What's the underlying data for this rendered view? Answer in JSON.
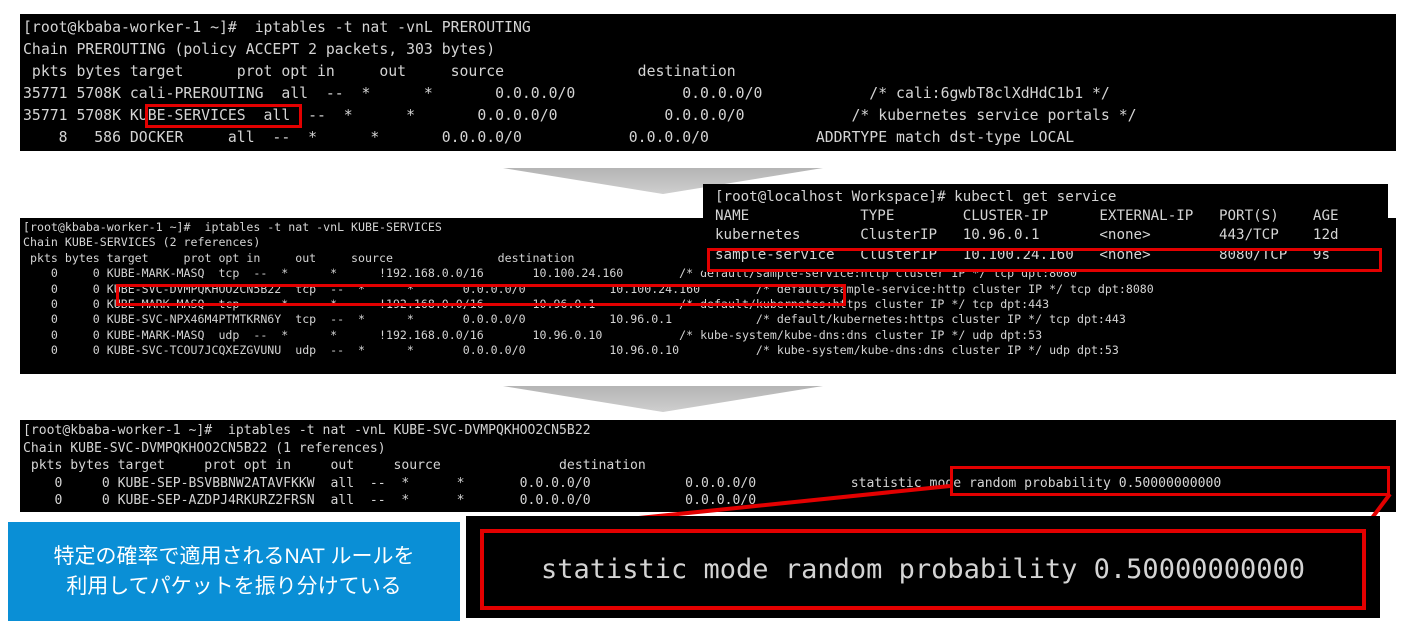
{
  "terminal1": {
    "lines": [
      "[root@kbaba-worker-1 ~]#  iptables -t nat -vnL PREROUTING",
      "Chain PREROUTING (policy ACCEPT 2 packets, 303 bytes)",
      " pkts bytes target      prot opt in     out     source               destination",
      "35771 5708K cali-PREROUTING  all  --  *      *       0.0.0.0/0            0.0.0.0/0            /* cali:6gwbT8clXdHdC1b1 */",
      "35771 5708K KUBE-SERVICES  all  --  *      *       0.0.0.0/0            0.0.0.0/0            /* kubernetes service portals */",
      "    8   586 DOCKER     all  --  *      *       0.0.0.0/0            0.0.0.0/0            ADDRTYPE match dst-type LOCAL"
    ]
  },
  "terminal2": {
    "lines": [
      "[root@kbaba-worker-1 ~]#  iptables -t nat -vnL KUBE-SERVICES",
      "Chain KUBE-SERVICES (2 references)",
      " pkts bytes target     prot opt in     out     source               destination",
      "    0     0 KUBE-MARK-MASQ  tcp  --  *      *      !192.168.0.0/16       10.100.24.160        /* default/sample-service:http cluster IP */ tcp dpt:8080",
      "    0     0 KUBE-SVC-DVMPQKHOO2CN5B22  tcp  --  *      *       0.0.0.0/0            10.100.24.160        /* default/sample-service:http cluster IP */ tcp dpt:8080",
      "    0     0 KUBE-MARK-MASQ  tcp  --  *      *      !192.168.0.0/16       10.96.0.1            /* default/kubernetes:https cluster IP */ tcp dpt:443",
      "    0     0 KUBE-SVC-NPX46M4PTMTKRN6Y  tcp  --  *      *       0.0.0.0/0            10.96.0.1            /* default/kubernetes:https cluster IP */ tcp dpt:443",
      "    0     0 KUBE-MARK-MASQ  udp  --  *      *      !192.168.0.0/16       10.96.0.10           /* kube-system/kube-dns:dns cluster IP */ udp dpt:53",
      "    0     0 KUBE-SVC-TCOU7JCQXEZGVUNU  udp  --  *      *       0.0.0.0/0            10.96.0.10           /* kube-system/kube-dns:dns cluster IP */ udp dpt:53"
    ]
  },
  "terminal3": {
    "lines": [
      "[root@kbaba-worker-1 ~]#  iptables -t nat -vnL KUBE-SVC-DVMPQKHOO2CN5B22",
      "Chain KUBE-SVC-DVMPQKHOO2CN5B22 (1 references)",
      " pkts bytes target     prot opt in     out     source               destination",
      "    0     0 KUBE-SEP-BSVBBNW2ATAVFKKW  all  --  *      *       0.0.0.0/0            0.0.0.0/0            statistic mode random probability 0.50000000000",
      "    0     0 KUBE-SEP-AZDPJ4RKURZ2FRSN  all  --  *      *       0.0.0.0/0            0.0.0.0/0"
    ]
  },
  "terminal4": {
    "lines": [
      "[root@localhost Workspace]# kubectl get service",
      "NAME             TYPE        CLUSTER-IP      EXTERNAL-IP   PORT(S)    AGE",
      "kubernetes       ClusterIP   10.96.0.1       <none>        443/TCP    12d",
      "sample-service   ClusterIP   10.100.24.160   <none>        8080/TCP   9s"
    ]
  },
  "callout": {
    "line1": "特定の確率で適用されるNAT ルールを",
    "line2": "利用してパケットを振り分けている"
  },
  "zoom": {
    "text": "statistic mode random probability 0.50000000000"
  },
  "colors": {
    "highlight": "#e30000",
    "callout_bg": "#0a8fd6",
    "terminal_bg": "#000000",
    "terminal_fg": "#d4d4d4"
  }
}
